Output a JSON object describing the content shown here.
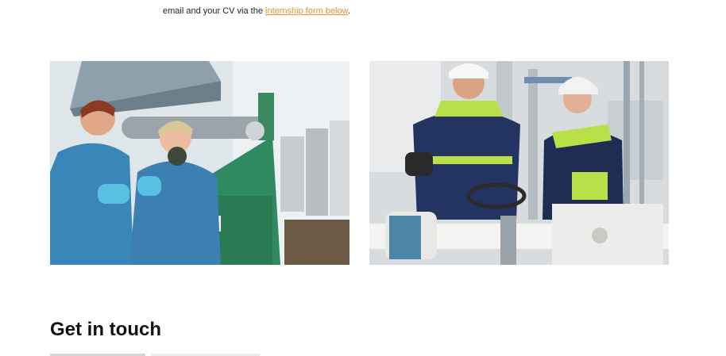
{
  "intro": {
    "text_before": "email and your CV via the ",
    "link_text": "internship form below",
    "text_after": "."
  },
  "photos": [
    {
      "name": "laboratory-photo",
      "icon": "photo-lab-workers"
    },
    {
      "name": "industrial-site-photo",
      "icon": "photo-plant-workers"
    }
  ],
  "contact": {
    "title": "Get in touch"
  },
  "colors": {
    "link": "#e8912a",
    "heading": "#111111",
    "background": "#ffffff"
  }
}
